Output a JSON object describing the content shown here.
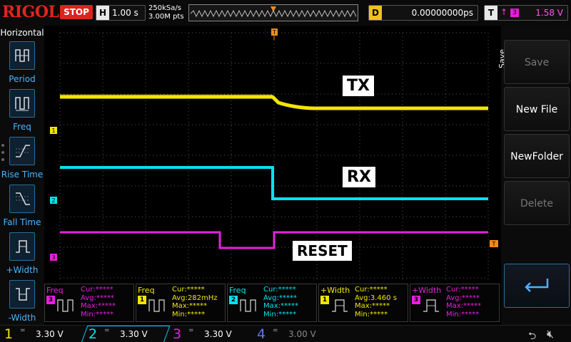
{
  "header": {
    "brand": "RIGOL",
    "run_state": "STOP",
    "timebase_tag": "H",
    "timebase": "1.00 s",
    "sample_rate": "250kSa/s",
    "memory_depth": "3.00M pts",
    "delay_tag": "D",
    "delay": "0.00000000ps",
    "trigger_tag": "T",
    "trigger_source": "3",
    "trigger_level": "1.58 V"
  },
  "left_menu": {
    "title": "Horizontal",
    "items": [
      {
        "label": "Period",
        "icon": "period-icon"
      },
      {
        "label": "Freq",
        "icon": "frequency-icon"
      },
      {
        "label": "Rise Time",
        "icon": "rise-time-icon"
      },
      {
        "label": "Fall Time",
        "icon": "fall-time-icon"
      },
      {
        "label": "+Width",
        "icon": "positive-width-icon"
      },
      {
        "label": "-Width",
        "icon": "negative-width-icon"
      }
    ]
  },
  "right_menu": {
    "title": "Save",
    "buttons": [
      {
        "label": "Save",
        "enabled": false
      },
      {
        "label": "New File",
        "enabled": true
      },
      {
        "label": "NewFolder",
        "enabled": true
      },
      {
        "label": "Delete",
        "enabled": false
      }
    ],
    "return_icon": "return-arrow-icon"
  },
  "waveform": {
    "labels": {
      "tx": "TX",
      "rx": "RX",
      "reset": "RESET"
    },
    "channel_markers": [
      "1",
      "2",
      "3"
    ],
    "trigger_marker": "T",
    "colors": {
      "ch1": "#f2e600",
      "ch2": "#00e5f0",
      "ch3": "#e820e0",
      "ch4": "#5a7bd8",
      "trigger": "#f08c1a",
      "grid": "#5a5a5a"
    }
  },
  "measurements": [
    {
      "name": "Freq",
      "source": "3",
      "cur": "Cur:*****",
      "avg": "Avg:*****",
      "max": "Max:*****",
      "min": "Min:*****"
    },
    {
      "name": "Freq",
      "source": "1",
      "cur": "Cur:*****",
      "avg": "Avg:282mHz",
      "max": "Max:*****",
      "min": "Min:*****"
    },
    {
      "name": "Freq",
      "source": "2",
      "cur": "Cur:*****",
      "avg": "Avg:*****",
      "max": "Max:*****",
      "min": "Min:*****"
    },
    {
      "name": "+Width",
      "source": "1",
      "cur": "Cur:*****",
      "avg": "Avg:3.460 s",
      "max": "Max:*****",
      "min": "Min:*****"
    },
    {
      "name": "+Width",
      "source": "3",
      "cur": "Cur:*****",
      "avg": "Avg:*****",
      "max": "Max:*****",
      "min": "Min:*****"
    }
  ],
  "channels": [
    {
      "num": "1",
      "coupling": "=",
      "scale": "3.30 V"
    },
    {
      "num": "2",
      "coupling": "=",
      "scale": "3.30 V"
    },
    {
      "num": "3",
      "coupling": "=",
      "scale": "3.30 V"
    },
    {
      "num": "4",
      "coupling": "=",
      "scale": "3.00 V"
    }
  ],
  "status_icons": [
    "usb-icon",
    "speaker-mute-icon"
  ]
}
